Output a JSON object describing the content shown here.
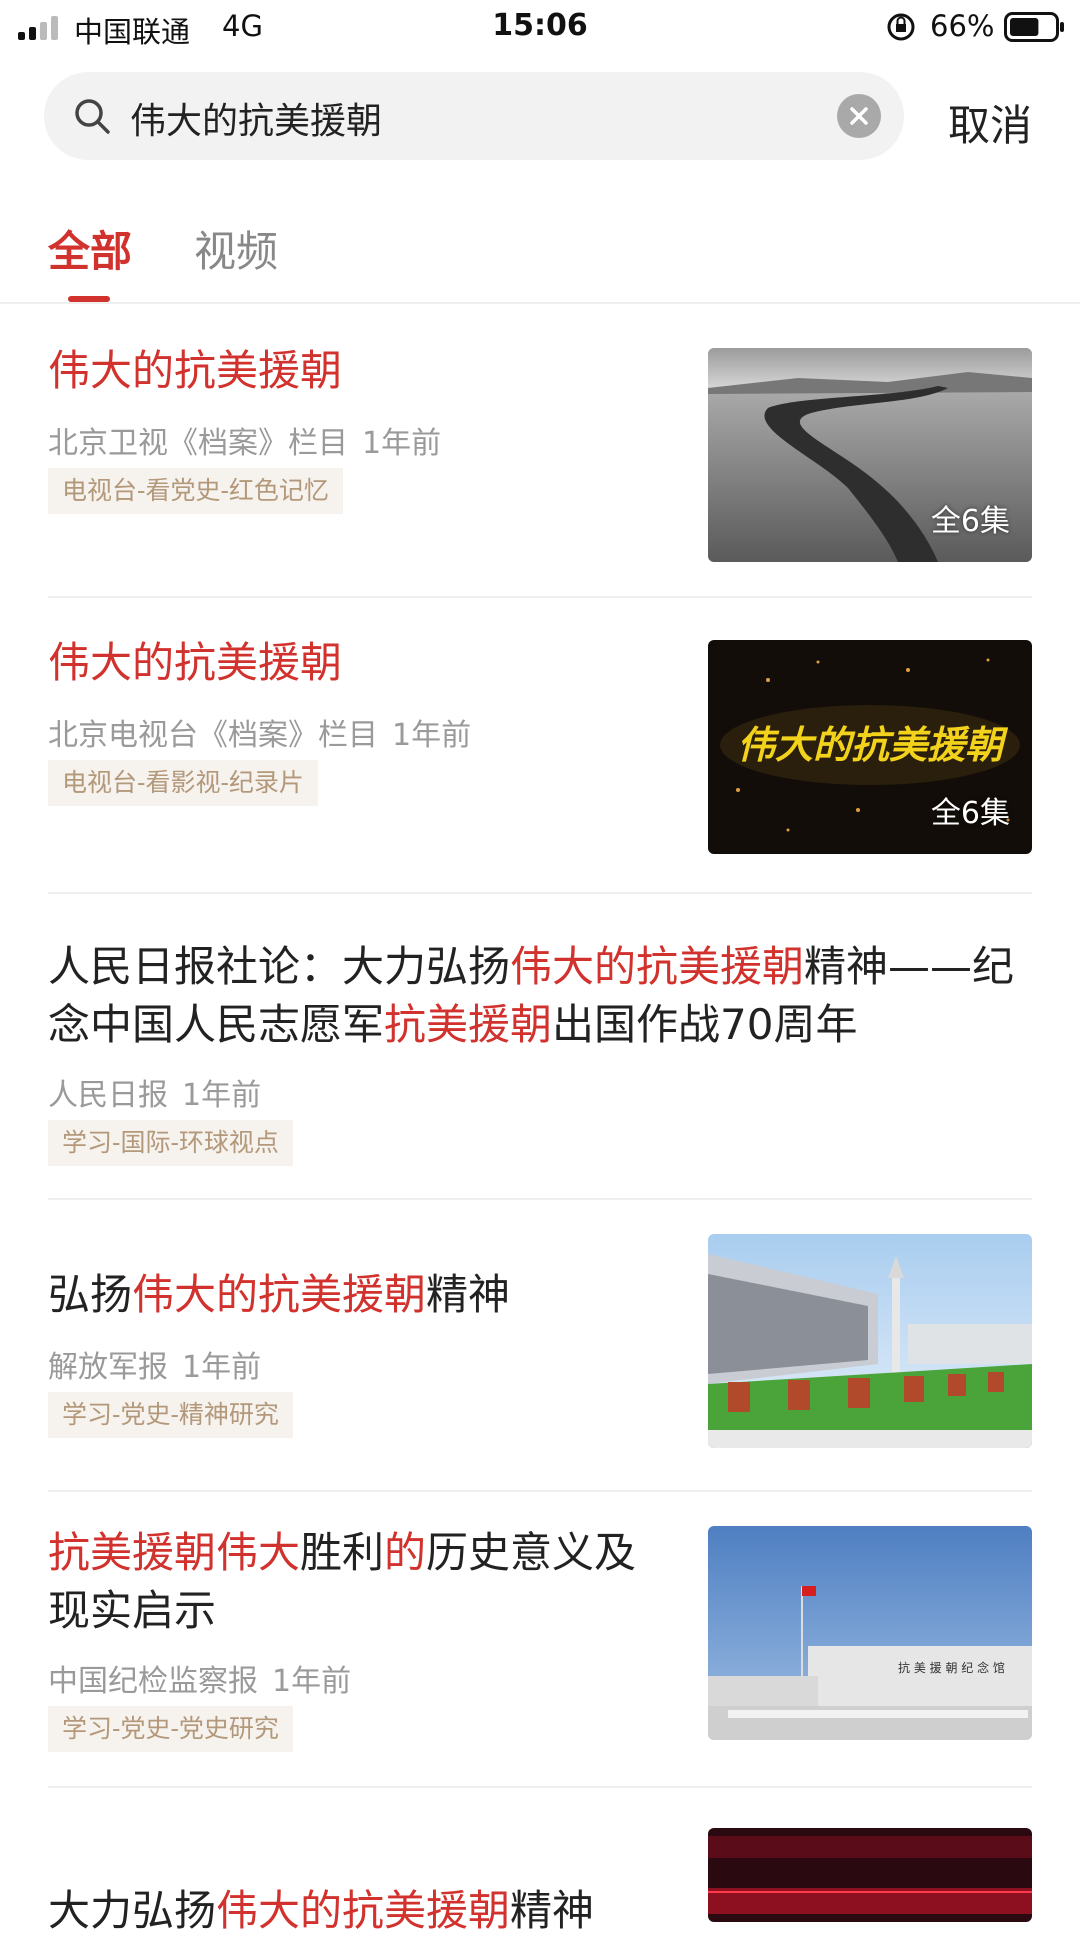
{
  "status_bar": {
    "carrier": "中国联通",
    "network": "4G",
    "time": "15:06",
    "battery": "66%",
    "battery_level": 0.66
  },
  "search": {
    "query": "伟大的抗美援朝",
    "cancel_label": "取消"
  },
  "tabs": [
    {
      "label": "全部",
      "active": true
    },
    {
      "label": "视频",
      "active": false
    }
  ],
  "results": [
    {
      "title_parts": [
        {
          "text": "伟大的抗美援朝",
          "hl": true
        }
      ],
      "source": "北京卫视《档案》栏目",
      "time": "1年前",
      "tag": "电视台-看党史-红色记忆",
      "episodes": "全6集"
    },
    {
      "title_parts": [
        {
          "text": "伟大的抗美援朝",
          "hl": true
        }
      ],
      "source": "北京电视台《档案》栏目",
      "time": "1年前",
      "tag": "电视台-看影视-纪录片",
      "episodes": "全6集",
      "thumb_text": "伟大的抗美援朝"
    },
    {
      "title_line1": [
        {
          "text": "人民日报社论：大力弘扬",
          "hl": false
        },
        {
          "text": "伟大的抗美援朝",
          "hl": true
        },
        {
          "text": "精神——纪",
          "hl": false
        }
      ],
      "title_line2": [
        {
          "text": "念中国人民志愿军",
          "hl": false
        },
        {
          "text": "抗美援朝",
          "hl": true
        },
        {
          "text": "出国作战70周年",
          "hl": false
        }
      ],
      "source": "人民日报",
      "time": "1年前",
      "tag": "学习-国际-环球视点"
    },
    {
      "title_parts": [
        {
          "text": "弘扬",
          "hl": false
        },
        {
          "text": "伟大的抗美援朝",
          "hl": true
        },
        {
          "text": "精神",
          "hl": false
        }
      ],
      "source": "解放军报",
      "time": "1年前",
      "tag": "学习-党史-精神研究"
    },
    {
      "title_line1": [
        {
          "text": "抗美援朝伟大",
          "hl": true
        },
        {
          "text": "胜利",
          "hl": false
        },
        {
          "text": "的",
          "hl": true
        },
        {
          "text": "历史意义及",
          "hl": false
        }
      ],
      "title_line2": [
        {
          "text": "现实启示",
          "hl": false
        }
      ],
      "source": "中国纪检监察报",
      "time": "1年前",
      "tag": "学习-党史-党史研究"
    },
    {
      "title_parts": [
        {
          "text": "大力弘扬",
          "hl": false
        },
        {
          "text": "伟大的抗美援朝",
          "hl": true
        },
        {
          "text": "精神",
          "hl": false
        }
      ]
    }
  ],
  "colors": {
    "accent": "#d2322d",
    "meta_text": "#9a9a9a",
    "tag_bg": "#f6f2ee",
    "tag_text": "#b3987a"
  }
}
